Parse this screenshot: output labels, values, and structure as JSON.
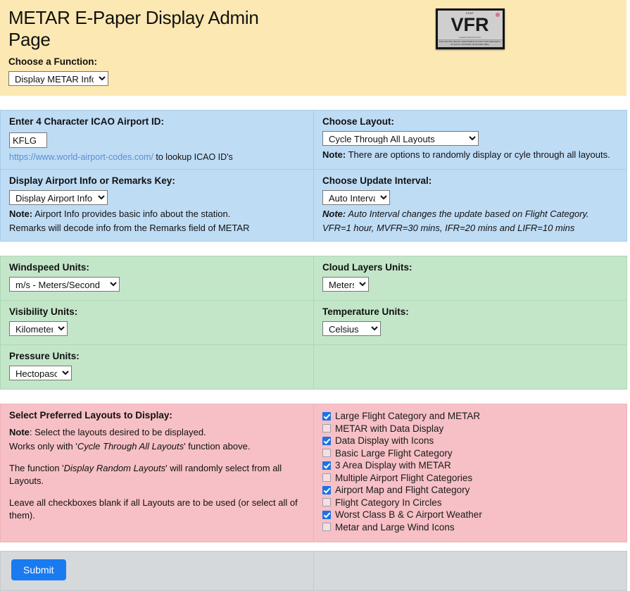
{
  "header": {
    "title": "METAR E-Paper Display Admin Page",
    "function_label": "Choose a Function:",
    "function_value": "Display METAR Info",
    "function_options": [
      "Display METAR Info"
    ],
    "device_preview": {
      "station": "KSAT",
      "category": "VFR",
      "caption": "Updated 2022/12/05 13:29",
      "metar_text": "KSAT 051753Z 15012KT 10SM FEW045 SCT250 17/09 A3006 RMK AO2 SLP172 T01720094 10178 20061 58011"
    }
  },
  "blue": {
    "icao_label": "Enter 4 Character ICAO Airport ID:",
    "icao_value": "KFLG",
    "icao_link_text": "https://www.world-airport-codes.com/",
    "icao_link_suffix": " to lookup ICAO ID's",
    "layout_label": "Choose Layout:",
    "layout_value": "Cycle Through All Layouts",
    "layout_note_bold": "Note:",
    "layout_note_text": " There are options to randomly display or cyle through all layouts.",
    "airportinfo_label": "Display Airport Info or Remarks Key:",
    "airportinfo_value": "Display Airport Info",
    "airportinfo_note_bold": "Note:",
    "airportinfo_note_line1": " Airport Info provides basic info about the station.",
    "airportinfo_note_line2": "Remarks will decode info from the Remarks field of METAR",
    "interval_label": "Choose Update Interval:",
    "interval_value": "Auto Interval",
    "interval_note_bold": "Note:",
    "interval_note_line1": " Auto Interval changes the update based on Flight Category.",
    "interval_note_line2": "VFR=1 hour, MVFR=30 mins, IFR=20 mins and LIFR=10 mins"
  },
  "green": {
    "windspeed_label": "Windspeed Units:",
    "windspeed_value": "m/s - Meters/Second",
    "cloud_label": "Cloud Layers Units:",
    "cloud_value": "Meters",
    "visibility_label": "Visibility Units:",
    "visibility_value": "Kilometers",
    "temperature_label": "Temperature Units:",
    "temperature_value": "Celsius",
    "pressure_label": "Pressure Units:",
    "pressure_value": "Hectopascal"
  },
  "pink": {
    "title": "Select Preferred Layouts to Display:",
    "note_bold": "Note",
    "note_line1": ": Select the layouts desired to be displayed.",
    "note_line2a": "Works only with '",
    "note_line2_ital": "Cycle Through All Layouts",
    "note_line2b": "' function above.",
    "para2a": "The function '",
    "para2_ital": "Display Random Layouts",
    "para2b": "' will randomly select from all Layouts.",
    "para3": "Leave all checkboxes blank if all Layouts are to be used (or select all of them).",
    "layouts": [
      {
        "label": "Large Flight Category and METAR",
        "checked": true
      },
      {
        "label": "METAR with Data Display",
        "checked": false
      },
      {
        "label": "Data Display with Icons",
        "checked": true
      },
      {
        "label": "Basic Large Flight Category",
        "checked": false
      },
      {
        "label": "3 Area Display with METAR",
        "checked": true
      },
      {
        "label": "Multiple Airport Flight Categories",
        "checked": false
      },
      {
        "label": "Airport Map and Flight Category",
        "checked": true
      },
      {
        "label": "Flight Category In Circles",
        "checked": false
      },
      {
        "label": "Worst Class B & C Airport Weather",
        "checked": true
      },
      {
        "label": "Metar and Large Wind Icons",
        "checked": false
      }
    ]
  },
  "footer": {
    "submit_label": "Submit"
  },
  "colors": {
    "header_bg": "#fce8b2",
    "blue_bg": "#bfdcf5",
    "green_bg": "#c3e6c9",
    "pink_bg": "#f6c0c6",
    "gray_bg": "#d6d9dc",
    "accent": "#1a7af0",
    "link": "#5b8fd4"
  }
}
